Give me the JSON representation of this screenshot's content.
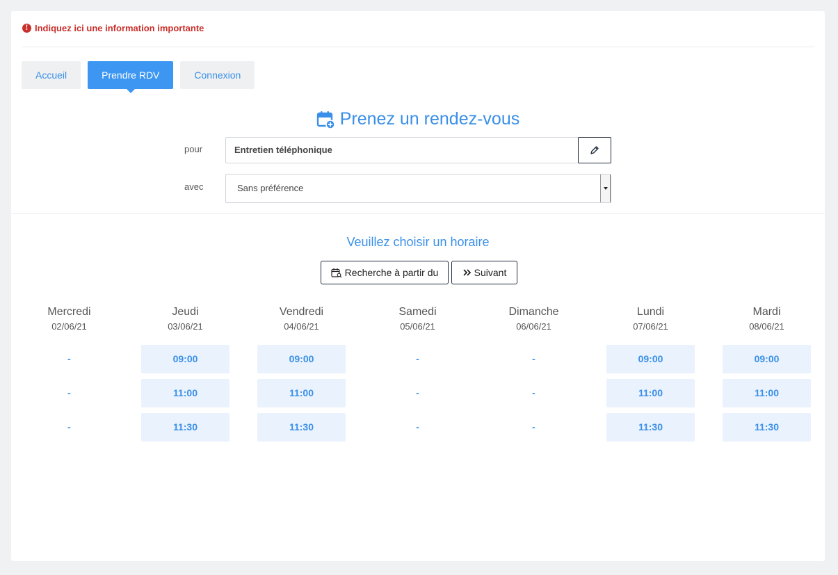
{
  "alert": {
    "text": "Indiquez ici une information importante",
    "icon": "exclamation-circle-icon"
  },
  "nav": {
    "tabs": [
      {
        "label": "Accueil",
        "active": false
      },
      {
        "label": "Prendre RDV",
        "active": true
      },
      {
        "label": "Connexion",
        "active": false
      }
    ]
  },
  "form": {
    "title": "Prenez un rendez-vous",
    "pour_label": "pour",
    "pour_value": "Entretien téléphonique",
    "avec_label": "avec",
    "avec_value": "Sans préférence"
  },
  "schedule": {
    "title": "Veuillez choisir un horaire",
    "search_label": "Recherche à partir du",
    "next_label": "Suivant",
    "days": [
      {
        "name": "Mercredi",
        "date": "02/06/21",
        "slots": [
          "-",
          "-",
          "-"
        ]
      },
      {
        "name": "Jeudi",
        "date": "03/06/21",
        "slots": [
          "09:00",
          "11:00",
          "11:30"
        ]
      },
      {
        "name": "Vendredi",
        "date": "04/06/21",
        "slots": [
          "09:00",
          "11:00",
          "11:30"
        ]
      },
      {
        "name": "Samedi",
        "date": "05/06/21",
        "slots": [
          "-",
          "-",
          "-"
        ]
      },
      {
        "name": "Dimanche",
        "date": "06/06/21",
        "slots": [
          "-",
          "-",
          "-"
        ]
      },
      {
        "name": "Lundi",
        "date": "07/06/21",
        "slots": [
          "09:00",
          "11:00",
          "11:30"
        ]
      },
      {
        "name": "Mardi",
        "date": "08/06/21",
        "slots": [
          "09:00",
          "11:00",
          "11:30"
        ]
      }
    ]
  },
  "colors": {
    "accent": "#3d97f2",
    "alert": "#c9302c",
    "slot_bg": "#e9f2fd"
  }
}
